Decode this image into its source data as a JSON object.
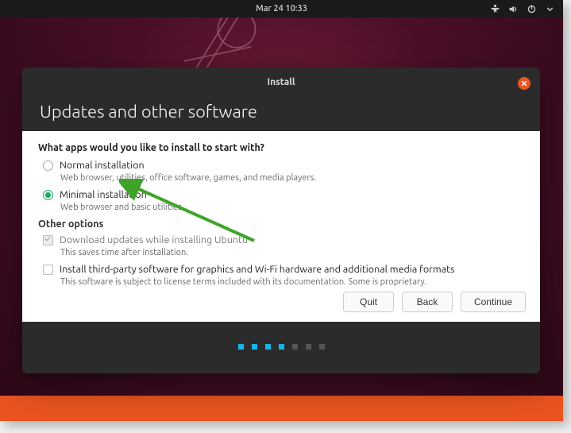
{
  "topbar": {
    "clock": "Mar 24  10:33"
  },
  "installer": {
    "window_title": "Install",
    "heading": "Updates and other software",
    "question": "What apps would you like to install to start with?",
    "normal": {
      "label": "Normal installation",
      "desc": "Web browser, utilities, office software, games, and media players."
    },
    "minimal": {
      "label": "Minimal installation",
      "desc": "Web browser and basic utilities."
    },
    "other_heading": "Other options",
    "updates": {
      "label": "Download updates while installing Ubuntu",
      "desc": "This saves time after installation."
    },
    "thirdparty": {
      "label": "Install third-party software for graphics and Wi-Fi hardware and additional media formats",
      "desc": "This software is subject to license terms included with its documentation. Some is proprietary."
    },
    "buttons": {
      "quit": "Quit",
      "back": "Back",
      "continue": "Continue"
    }
  },
  "progress": {
    "total": 7,
    "current": 4
  }
}
